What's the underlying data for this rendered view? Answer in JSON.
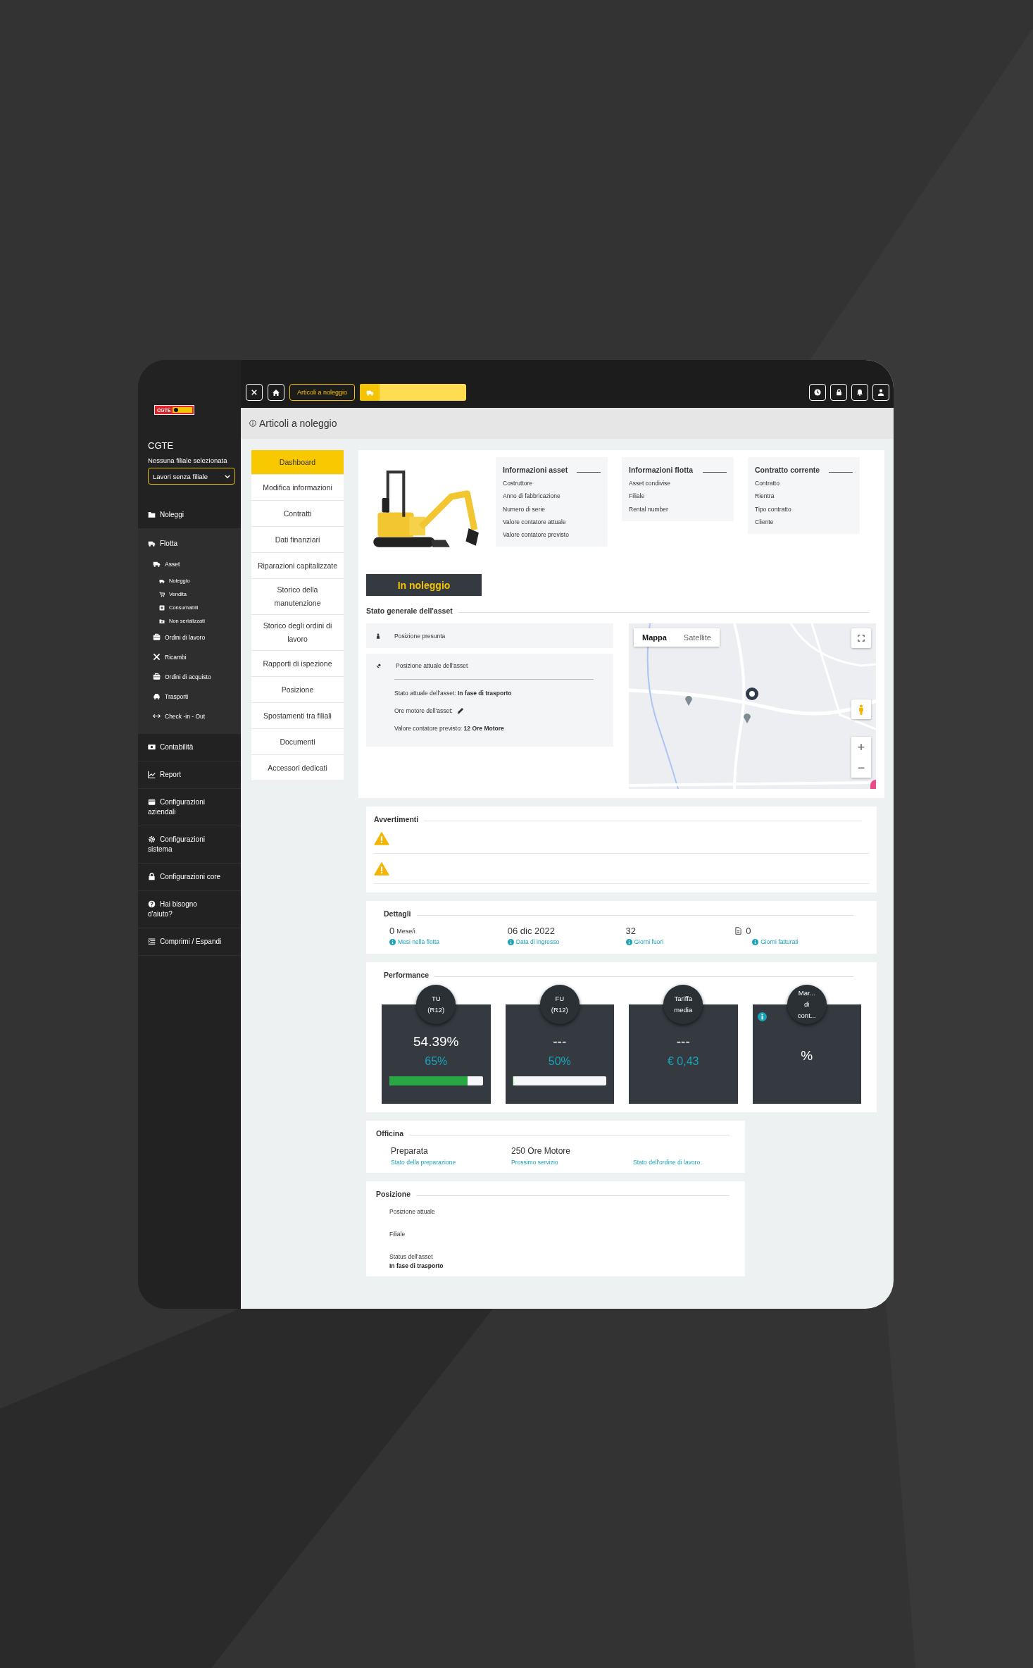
{
  "top_bar": {
    "tab": "Articoli a noleggio"
  },
  "sidebar": {
    "logo": "CGTE",
    "company": "CGTE",
    "branch_note": "Nessuna filiale selezionata",
    "branch_select": "Lavori senza filiale",
    "items": [
      {
        "label": "Noleggi"
      },
      {
        "label": "Flotta",
        "expanded": true,
        "children": [
          {
            "label": "Asset",
            "expanded": true,
            "children": [
              {
                "label": "Noleggio"
              },
              {
                "label": "Vendita"
              },
              {
                "label": "Consumabili"
              },
              {
                "label": "Non serializzati"
              }
            ]
          },
          {
            "label": "Ordini di lavoro"
          },
          {
            "label": "Ricambi"
          },
          {
            "label": "Ordini di acquisto"
          },
          {
            "label": "Trasporti"
          },
          {
            "label": "Check -in - Out"
          }
        ]
      },
      {
        "label": "Contabilità"
      },
      {
        "label": "Report"
      },
      {
        "label": "Configurazioni aziendali"
      },
      {
        "label": "Configurazioni sistema"
      },
      {
        "label": "Configurazioni core"
      },
      {
        "label": "Hai bisogno d'aiuto?"
      },
      {
        "label": "Comprimi / Espandi"
      }
    ]
  },
  "page_header": {
    "title": "Articoli a noleggio"
  },
  "asset_nav": [
    {
      "label": "Dashboard",
      "selected": true
    },
    {
      "label": "Modifica informazioni",
      "selected": false
    },
    {
      "label": "Contratti",
      "selected": false
    },
    {
      "label": "Dati finanziari",
      "selected": false
    },
    {
      "label": "Riparazioni capitalizzate",
      "selected": false
    },
    {
      "label": "Storico della manutenzione",
      "selected": false
    },
    {
      "label": "Storico degli ordini di lavoro",
      "selected": false
    },
    {
      "label": "Rapporti di ispezione",
      "selected": false
    },
    {
      "label": "Posizione",
      "selected": false
    },
    {
      "label": "Spostamenti tra filiali",
      "selected": false
    },
    {
      "label": "Documenti",
      "selected": false
    },
    {
      "label": "Accessori dedicati",
      "selected": false
    }
  ],
  "asset": {
    "status": "In noleggio",
    "info_cards": [
      {
        "title": "Informazioni asset",
        "fields": [
          "Costruttore",
          "Anno di fabbricazione",
          "Numero di serie",
          "Valore contatore attuale",
          "Valore contatore previsto"
        ]
      },
      {
        "title": "Informazioni flotta",
        "fields": [
          "Asset condivise",
          "Filiale",
          "Rental number"
        ]
      },
      {
        "title": "Contratto corrente",
        "fields": [
          "Contratto",
          "Rientra",
          "Tipo contratto",
          "Cliente"
        ]
      }
    ]
  },
  "general_status": {
    "title": "Stato generale dell'asset",
    "presumed_position": "Posizione presunta",
    "current_position": "Posizione attuale dell'asset",
    "details": [
      {
        "text": "Stato attuale dell'asset: **In fase di trasporto**",
        "editable": false
      },
      {
        "text": "Ore motore dell'asset:",
        "editable": true
      },
      {
        "text": "Valore contatore previsto: **12 Ore Motore**",
        "editable": false
      }
    ],
    "map": {
      "map_types": [
        {
          "label": "Mappa",
          "selected": true
        },
        {
          "label": "Satellite",
          "selected": false
        }
      ],
      "zoom_in": "+",
      "zoom_out": "−"
    }
  },
  "warnings": {
    "title": "Avvertimenti",
    "rows": [
      {
        "kind": "warning"
      },
      {
        "kind": "warning"
      }
    ]
  },
  "details": {
    "title": "Dettagli",
    "items": [
      {
        "kind": "plain",
        "value": "0",
        "unit": "Mese/i",
        "label": "Mesi nella flotta"
      },
      {
        "kind": "plain",
        "value": "06 dic 2022",
        "label": "Data di ingresso"
      },
      {
        "kind": "plain",
        "value": "32",
        "label": "Giorni fuori"
      },
      {
        "kind": "document",
        "value": "0",
        "label": "Giorni fatturati"
      }
    ]
  },
  "performance": {
    "title": "Performance",
    "cards": [
      {
        "title_lines": [
          "TU",
          "(R12)"
        ],
        "value": "54.39%",
        "target": "65%",
        "level": 0.84,
        "info": false
      },
      {
        "title_lines": [
          "FU",
          "(R12)"
        ],
        "value": "---",
        "target": "50%",
        "level": 0,
        "info": false
      },
      {
        "title_lines": [
          "Tariffa",
          "media"
        ],
        "value": "---",
        "target": "€ 0,43",
        "info": false
      },
      {
        "title_lines": [
          "Mar...",
          "di",
          "cont..."
        ],
        "value": "%",
        "info": true
      }
    ]
  },
  "workshop": {
    "title": "Officina",
    "items": [
      {
        "value": "Preparata",
        "label": "Stato della preparazione"
      },
      {
        "value": "250 Ore Motore",
        "label": "Prossimo servizio"
      },
      {
        "label": "Stato dell'ordine di lavoro"
      }
    ]
  },
  "position": {
    "title": "Posizione",
    "fields": [
      {
        "label": "Posizione attuale"
      },
      {
        "label": "Filiale"
      },
      {
        "label": "Status dell'asset",
        "value": "In fase di trasporto"
      }
    ]
  }
}
